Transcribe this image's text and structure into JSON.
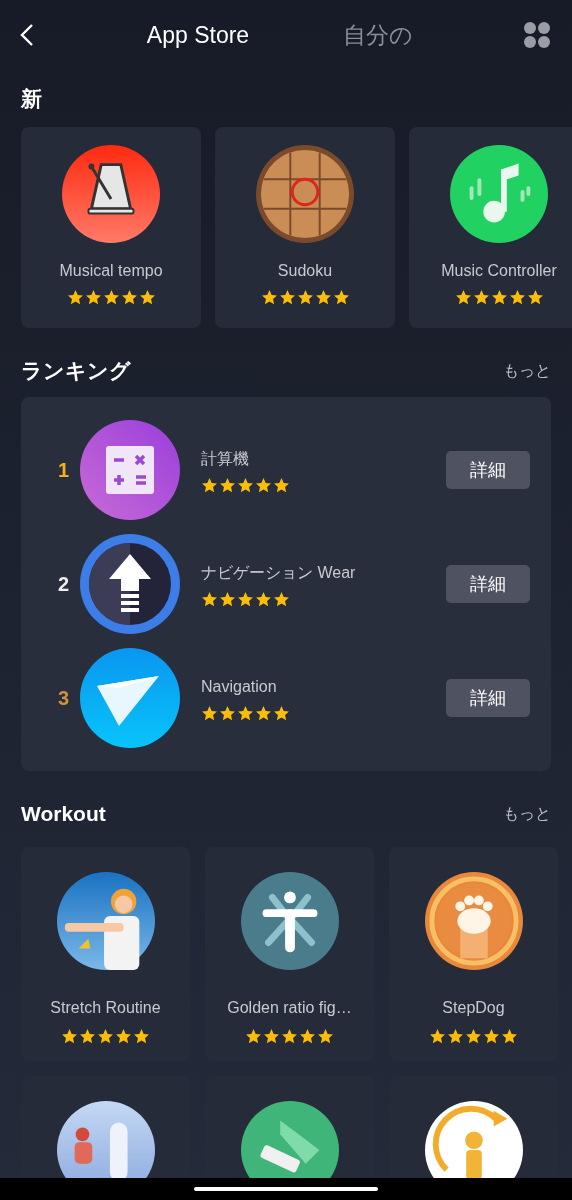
{
  "header": {
    "tabs": [
      {
        "label": "App Store",
        "selected": true
      },
      {
        "label": "自分の",
        "selected": false
      }
    ]
  },
  "new_apps": {
    "title": "新",
    "apps": [
      {
        "name": "Musical tempo",
        "stars": 5
      },
      {
        "name": "Sudoku",
        "stars": 5
      },
      {
        "name": "Music Controller",
        "stars": 5
      }
    ]
  },
  "ranking": {
    "title": "ランキング",
    "more": "もっと",
    "items": [
      {
        "rank": "1",
        "color": "#f2b21f",
        "name": "計算機",
        "stars": 5,
        "button": "詳細"
      },
      {
        "rank": "2",
        "color": "#eeeeee",
        "name": "ナビゲーション Wear",
        "stars": 5,
        "button": "詳細"
      },
      {
        "rank": "3",
        "color": "#d1923f",
        "name": "Navigation",
        "stars": 5,
        "button": "詳細"
      }
    ]
  },
  "workout": {
    "title": "Workout",
    "more": "もっと",
    "apps": [
      {
        "kind": "app",
        "name": "Stretch Routine",
        "stars": 5
      },
      {
        "kind": "app",
        "name": "Golden ratio fig…",
        "stars": 5
      },
      {
        "kind": "app",
        "name": "StepDog",
        "stars": 5
      },
      {
        "kind": "cut_off"
      },
      {
        "kind": "cut_off"
      },
      {
        "kind": "cut_off"
      }
    ]
  }
}
